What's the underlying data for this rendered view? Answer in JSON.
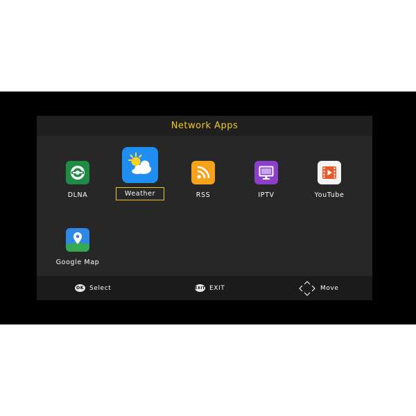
{
  "header": {
    "title": "Network Apps"
  },
  "apps": [
    {
      "label": "DLNA",
      "icon": "dlna-icon",
      "color": "#1e8c45"
    },
    {
      "label": "Weather",
      "icon": "weather-icon",
      "color": "#1f8ef0",
      "selected": true
    },
    {
      "label": "RSS",
      "icon": "rss-icon",
      "color": "#f7a21b"
    },
    {
      "label": "IPTV",
      "icon": "tv-monitor-icon",
      "color": "#8e3fc9"
    },
    {
      "label": "YouTube",
      "icon": "youtube-icon",
      "color": "#e7582a"
    },
    {
      "label": "Google Map",
      "icon": "google-map-icon",
      "color": "#2f88e6"
    }
  ],
  "footer": {
    "ok_badge": "OK",
    "select_label": "Select",
    "exit_badge": "EXIT",
    "exit_label": "EXIT",
    "move_label": "Move"
  },
  "colors": {
    "accent": "#f2c81e",
    "panel": "#272727",
    "frame": "#000000"
  }
}
